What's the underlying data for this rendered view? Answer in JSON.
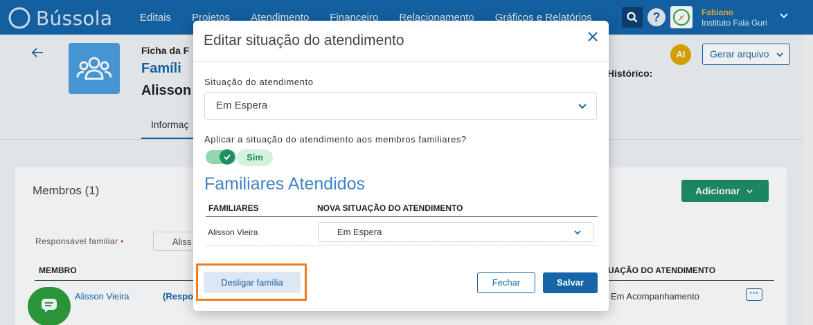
{
  "app": {
    "logo_text": "Bússola",
    "nav": [
      "Editais",
      "Projetos",
      "Atendimento",
      "Financeiro",
      "Relacionamento",
      "Gráficos e Relatórios"
    ],
    "help_label": "?",
    "user_name": "Fabiano",
    "user_org": "Instituto Fala Guri"
  },
  "page": {
    "ficha_label": "Ficha da F",
    "family_title": "Famíli",
    "family_person": "Alisson",
    "tab_info": "Informaç",
    "historico": "Histórico:",
    "avatar_initials": "AI",
    "gerar_arquivo": "Gerar arquivo",
    "members_title": "Membros (1)",
    "adicionar": "Adicionar",
    "responsavel_label": "Responsável familiar",
    "responsavel_star": "•",
    "responsavel_value": "Aliss",
    "col_membro": "MEMBRO",
    "col_situacao": "UAÇÃO DO ATENDIMENTO",
    "row": {
      "name": "Alisson Vieira",
      "responsavel": "(Respon",
      "situacao": "Em Acompanhamento",
      "more": "···"
    }
  },
  "modal": {
    "title": "Editar situação do atendimento",
    "situacao_label": "Situação do atendimento",
    "situacao_value": "Em Espera",
    "apply_label": "Aplicar a situação do atendimento aos membros familiares?",
    "toggle_on": true,
    "toggle_text": "Sim",
    "familiares_heading": "Familiares Atendidos",
    "col_familiares": "FAMILIARES",
    "col_nova_situacao": "NOVA SITUAÇÃO DO ATENDIMENTO",
    "rows": [
      {
        "name": "Alisson Vieira",
        "situacao": "Em Espera"
      }
    ],
    "desligar": "Desligar família",
    "fechar": "Fechar",
    "salvar": "Salvar"
  },
  "colors": {
    "primary": "#1565a8",
    "success": "#1d8f63",
    "highlight": "#f07c1d",
    "chat": "#2c9e3b"
  }
}
